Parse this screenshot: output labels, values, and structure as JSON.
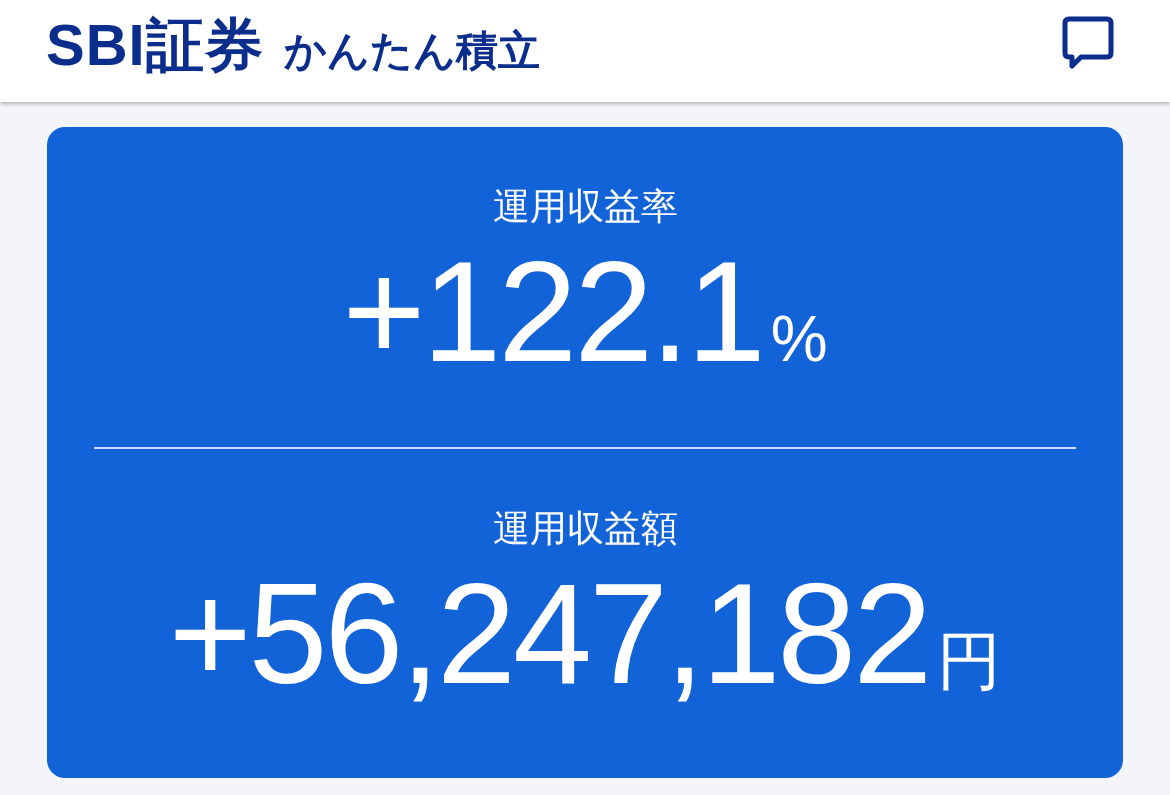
{
  "header": {
    "brand": "SBI証券",
    "service": "かんたん積立"
  },
  "summary": {
    "metrics": [
      {
        "label": "運用収益率",
        "value": "+122.1",
        "unit": "%"
      },
      {
        "label": "運用収益額",
        "value": "+56,247,182",
        "unit": "円"
      }
    ]
  }
}
